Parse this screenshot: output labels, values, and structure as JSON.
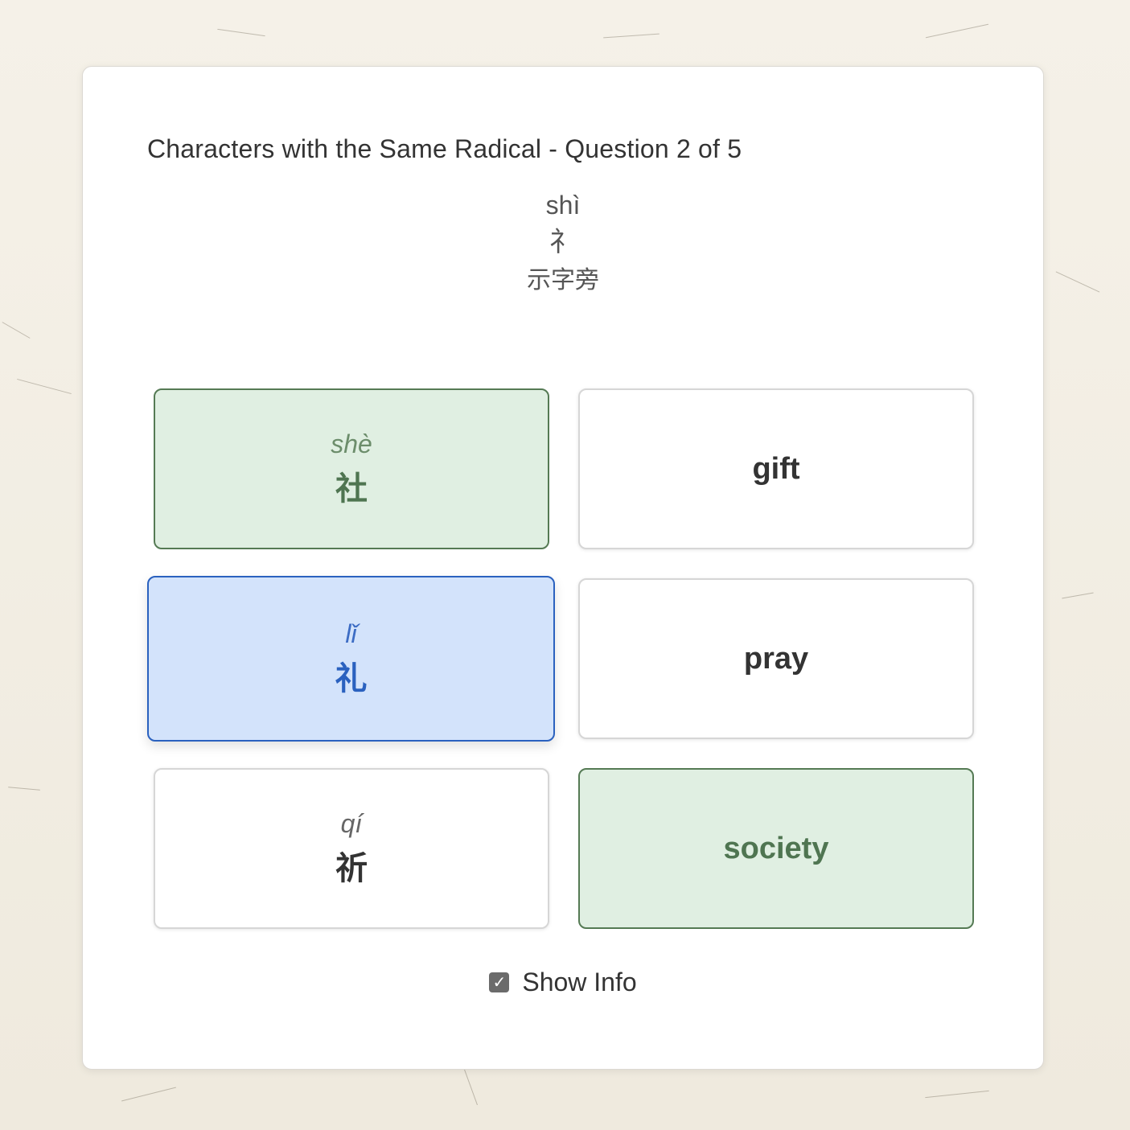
{
  "quiz": {
    "title": "Characters with the Same Radical - Question 2 of 5",
    "radical": {
      "pinyin": "shì",
      "character": "礻",
      "name": "示字旁"
    }
  },
  "tiles": [
    {
      "pinyin": "shè",
      "character": "社",
      "state": "matched"
    },
    {
      "text": "gift",
      "state": "default"
    },
    {
      "pinyin": "lǐ",
      "character": "礼",
      "state": "selected"
    },
    {
      "text": "pray",
      "state": "default"
    },
    {
      "pinyin": "qí",
      "character": "祈",
      "state": "default"
    },
    {
      "text": "society",
      "state": "matched"
    }
  ],
  "show_info": {
    "label": "Show Info",
    "checked": true,
    "check_icon": "checkmark-icon"
  },
  "colors": {
    "matched_bg": "#e0efe2",
    "matched_border": "#557a54",
    "selected_bg": "#d3e3fb",
    "selected_border": "#2a61bf"
  }
}
